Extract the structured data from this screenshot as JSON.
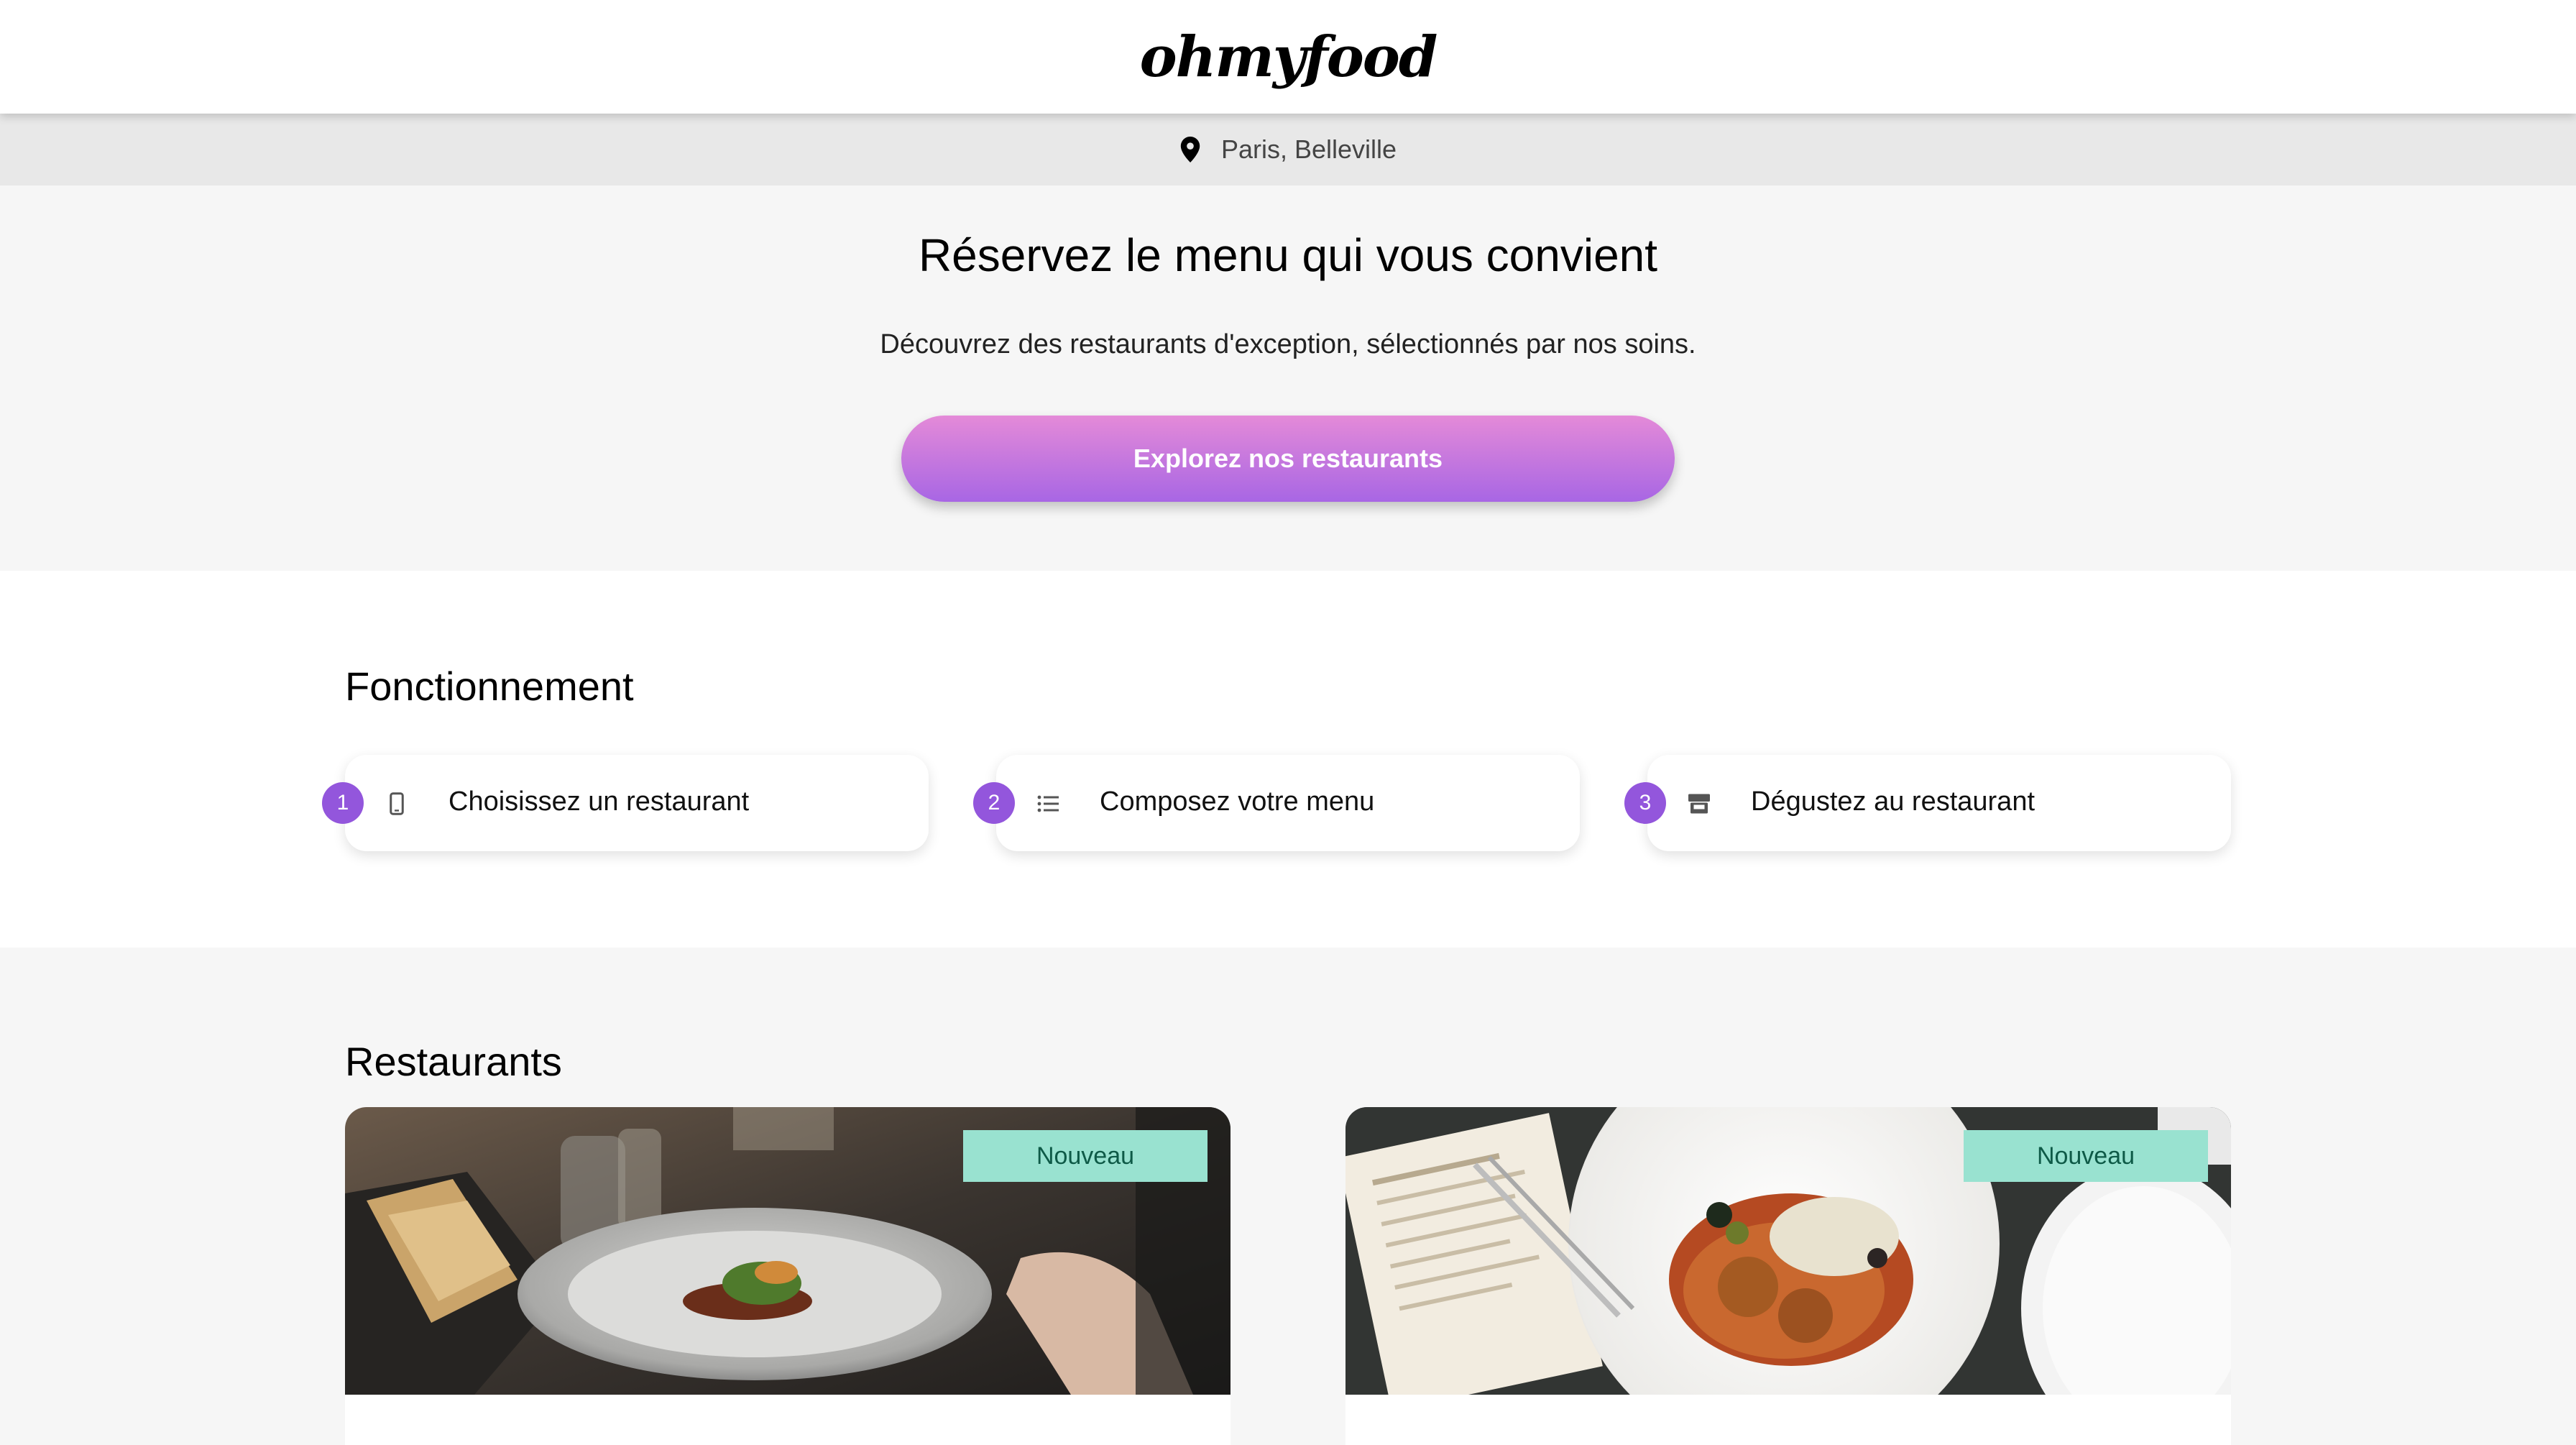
{
  "header": {
    "logo": "ohmyfood"
  },
  "location": {
    "icon": "location-pin-icon",
    "text": "Paris, Belleville"
  },
  "hero": {
    "title": "Réservez le menu qui vous convient",
    "subtitle": "Découvrez des restaurants d'exception, sélectionnés par nos soins.",
    "cta_label": "Explorez nos restaurants"
  },
  "how": {
    "title": "Fonctionnement",
    "steps": [
      {
        "number": "1",
        "icon": "phone-icon",
        "label": "Choisissez un restaurant"
      },
      {
        "number": "2",
        "icon": "list-icon",
        "label": "Composez votre menu"
      },
      {
        "number": "3",
        "icon": "store-icon",
        "label": "Dégustez au restaurant"
      }
    ]
  },
  "restaurants": {
    "title": "Restaurants",
    "cards": [
      {
        "badge": "Nouveau"
      },
      {
        "badge": "Nouveau"
      }
    ]
  },
  "colors": {
    "accent": "#9356dc",
    "cta_gradient_start": "#e48ad8",
    "cta_gradient_end": "#a866e4",
    "badge_bg": "#99e2d0",
    "badge_text": "#0e5a47"
  }
}
